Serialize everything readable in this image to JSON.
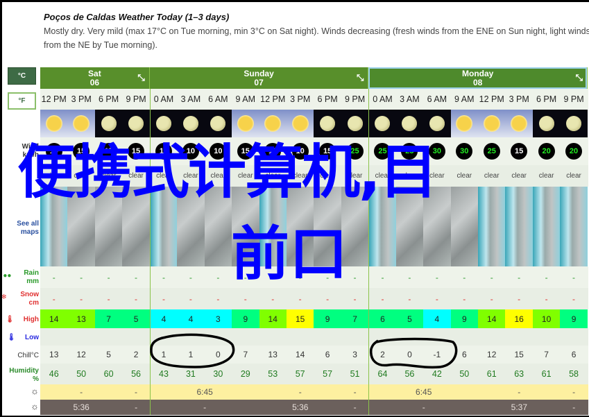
{
  "summary": {
    "title": "Poços de Caldas Weather Today (1–3 days)",
    "text": "Mostly dry. Very mild (max 17°C on Tue morning, min 3°C on Sat night). Winds decreasing (fresh winds from the ENE on Sun night, light winds from the NE by Tue morning)."
  },
  "units": {
    "celsius": "°C",
    "fahrenheit": "°F",
    "selected": "°C"
  },
  "labels": {
    "wind": "Wind",
    "wind_unit": "km/h",
    "see_all_maps": "See all maps",
    "rain": "Rain",
    "rain_unit": "mm",
    "snow": "Snow",
    "snow_unit": "cm",
    "high": "High",
    "low": "Low",
    "chill": "Chill°C",
    "humidity": "Humidity",
    "humidity_unit": "%"
  },
  "overlay": {
    "line1": "便携式计算机,目",
    "line2": "前口",
    "color": "#0000ff"
  },
  "days": [
    {
      "name": "Sat",
      "date": "06",
      "cols": 4
    },
    {
      "name": "Sunday",
      "date": "07",
      "cols": 8
    },
    {
      "name": "Monday",
      "date": "08",
      "cols": 8,
      "selected": true
    }
  ],
  "times": [
    "12 PM",
    "3 PM",
    "6 PM",
    "9 PM",
    "0 AM",
    "3 AM",
    "6 AM",
    "9 AM",
    "12 PM",
    "3 PM",
    "6 PM",
    "9 PM",
    "0 AM",
    "3 AM",
    "6 AM",
    "9 AM",
    "12 PM",
    "3 PM",
    "6 PM",
    "9 PM"
  ],
  "icons": [
    "sun",
    "sun",
    "moon",
    "moon",
    "moon",
    "moon",
    "moon",
    "sun",
    "sun",
    "sun",
    "moon",
    "moon",
    "moon",
    "moon",
    "moon",
    "sun",
    "sun",
    "sun",
    "moon",
    "moon"
  ],
  "wind": [
    10,
    15,
    15,
    15,
    10,
    10,
    10,
    15,
    10,
    10,
    15,
    25,
    25,
    25,
    30,
    30,
    25,
    15,
    20,
    20
  ],
  "conditions": [
    "clear",
    "clear",
    "clear",
    "clear",
    "clear",
    "clear",
    "clear",
    "clear",
    "clear",
    "clear",
    "clear",
    "clear",
    "clear",
    "clear",
    "clear",
    "clear",
    "clear",
    "clear",
    "clear",
    "clear"
  ],
  "rain": [
    "-",
    "-",
    "-",
    "-",
    "-",
    "-",
    "-",
    "-",
    "-",
    "-",
    "-",
    "-",
    "-",
    "-",
    "-",
    "-",
    "-",
    "-",
    "-",
    "-"
  ],
  "snow": [
    "-",
    "-",
    "-",
    "-",
    "-",
    "-",
    "-",
    "-",
    "-",
    "-",
    "-",
    "-",
    "-",
    "-",
    "-",
    "-",
    "-",
    "-",
    "-",
    "-"
  ],
  "high": [
    14,
    13,
    7,
    5,
    4,
    4,
    3,
    9,
    14,
    15,
    9,
    7,
    6,
    5,
    4,
    9,
    14,
    16,
    10,
    9
  ],
  "chill": [
    13,
    12,
    5,
    2,
    1,
    1,
    0,
    7,
    13,
    14,
    6,
    3,
    2,
    0,
    -1,
    6,
    12,
    15,
    7,
    6
  ],
  "humidity": [
    46,
    50,
    60,
    56,
    43,
    31,
    30,
    29,
    53,
    57,
    57,
    51,
    64,
    56,
    42,
    50,
    61,
    63,
    61,
    58
  ],
  "sunrise": [
    {
      "t": "",
      "span": 1
    },
    {
      "t": "-",
      "span": 1
    },
    {
      "t": "",
      "span": 1
    },
    {
      "t": "-",
      "span": 1
    },
    {
      "t": "6:45",
      "span": 4
    },
    {
      "t": "",
      "span": 1
    },
    {
      "t": "-",
      "span": 1
    },
    {
      "t": "",
      "span": 1
    },
    {
      "t": "-",
      "span": 1
    },
    {
      "t": "6:45",
      "span": 4
    },
    {
      "t": "",
      "span": 1
    },
    {
      "t": "-",
      "span": 1
    },
    {
      "t": "",
      "span": 1
    },
    {
      "t": "-",
      "span": 1
    }
  ],
  "sunset": [
    {
      "t": "5:36",
      "span": 3
    },
    {
      "t": "-",
      "span": 1
    },
    {
      "t": "-",
      "span": 4
    },
    {
      "t": "5:36",
      "span": 3
    },
    {
      "t": "-",
      "span": 1
    },
    {
      "t": "-",
      "span": 4
    },
    {
      "t": "5:37",
      "span": 3
    },
    {
      "t": "-",
      "span": 1
    }
  ],
  "colors": {
    "header": "#588f2b",
    "temp_cyan": "#00ffff",
    "temp_mint": "#00ff80",
    "temp_lime": "#80ff00",
    "temp_yellow": "#ffff00",
    "annotation": "#000000"
  }
}
